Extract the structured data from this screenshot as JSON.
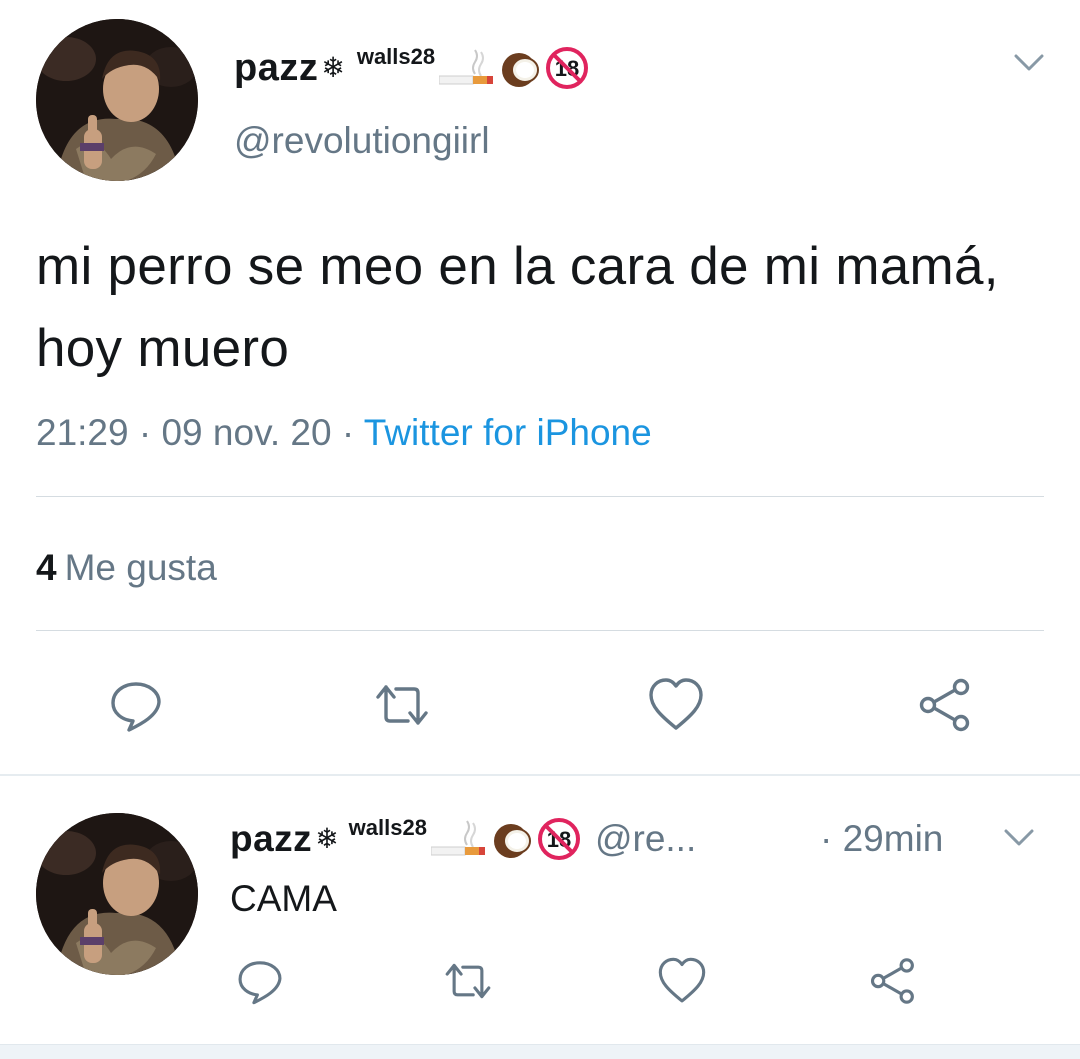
{
  "main_tweet": {
    "display_name": "pazz",
    "name_glyph": "❄",
    "small_name": "walls28",
    "name_emojis": [
      "cigarette-icon",
      "coconut-icon",
      "no-under-18-icon"
    ],
    "handle": "@revolutiongiirl",
    "text": "mi perro se meo en la cara de mi mamá, hoy muero",
    "time": "21:29",
    "date": "09 nov. 20",
    "source": "Twitter for iPhone",
    "sep": "·",
    "likes_count": "4",
    "likes_label": "Me gusta",
    "actions": [
      "reply-icon",
      "retweet-icon",
      "like-icon",
      "share-icon"
    ]
  },
  "reply": {
    "display_name": "pazz",
    "name_glyph": "❄",
    "small_name": "walls28",
    "handle": "@re...",
    "time": "· 29min",
    "text": "CAMA"
  },
  "colors": {
    "text": "#14171a",
    "muted": "#657786",
    "link": "#1b95e0",
    "icon": "#657786",
    "divider": "#e6ecf0"
  }
}
